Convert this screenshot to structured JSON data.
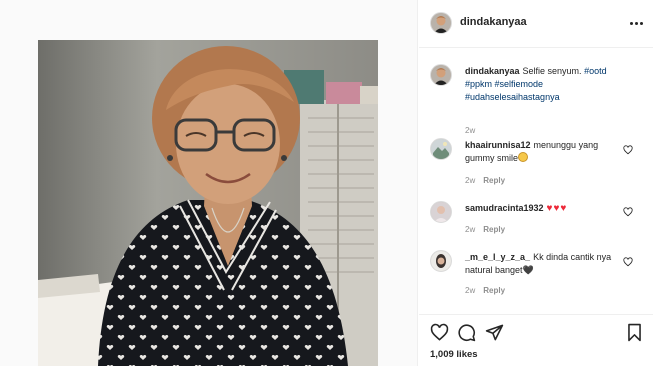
{
  "post": {
    "author": "dindakanyaa"
  },
  "caption": {
    "username": "dindakanyaa",
    "text": "Selfie senyum.",
    "hashtags": [
      "#ootd",
      "#ppkm",
      "#selfiemode",
      "#udahselesaihastagnya"
    ],
    "time": "2w"
  },
  "comments": [
    {
      "username": "khaairunnisa12",
      "text": "menunggu yang gummy smile",
      "emoji": "grinning-face-icon",
      "time": "2w",
      "reply": "Reply"
    },
    {
      "username": "samudracinta1932",
      "text": "♥♥♥",
      "time": "2w",
      "reply": "Reply"
    },
    {
      "username": "_m_e_l_y_z_a_",
      "text": "Kk dinda cantik nya natural banget🖤",
      "time": "2w",
      "reply": "Reply"
    }
  ],
  "likes": "1,009 likes",
  "icons": {
    "more": "more-options-icon",
    "like": "heart-outline-icon",
    "comment": "comment-bubble-icon",
    "share": "paper-plane-icon",
    "save": "bookmark-icon"
  },
  "colors": {
    "text": "#262626",
    "muted": "#8e8e8e",
    "hashtag": "#00376b",
    "heart_emoji": "#ed2939",
    "border": "#efefef"
  }
}
